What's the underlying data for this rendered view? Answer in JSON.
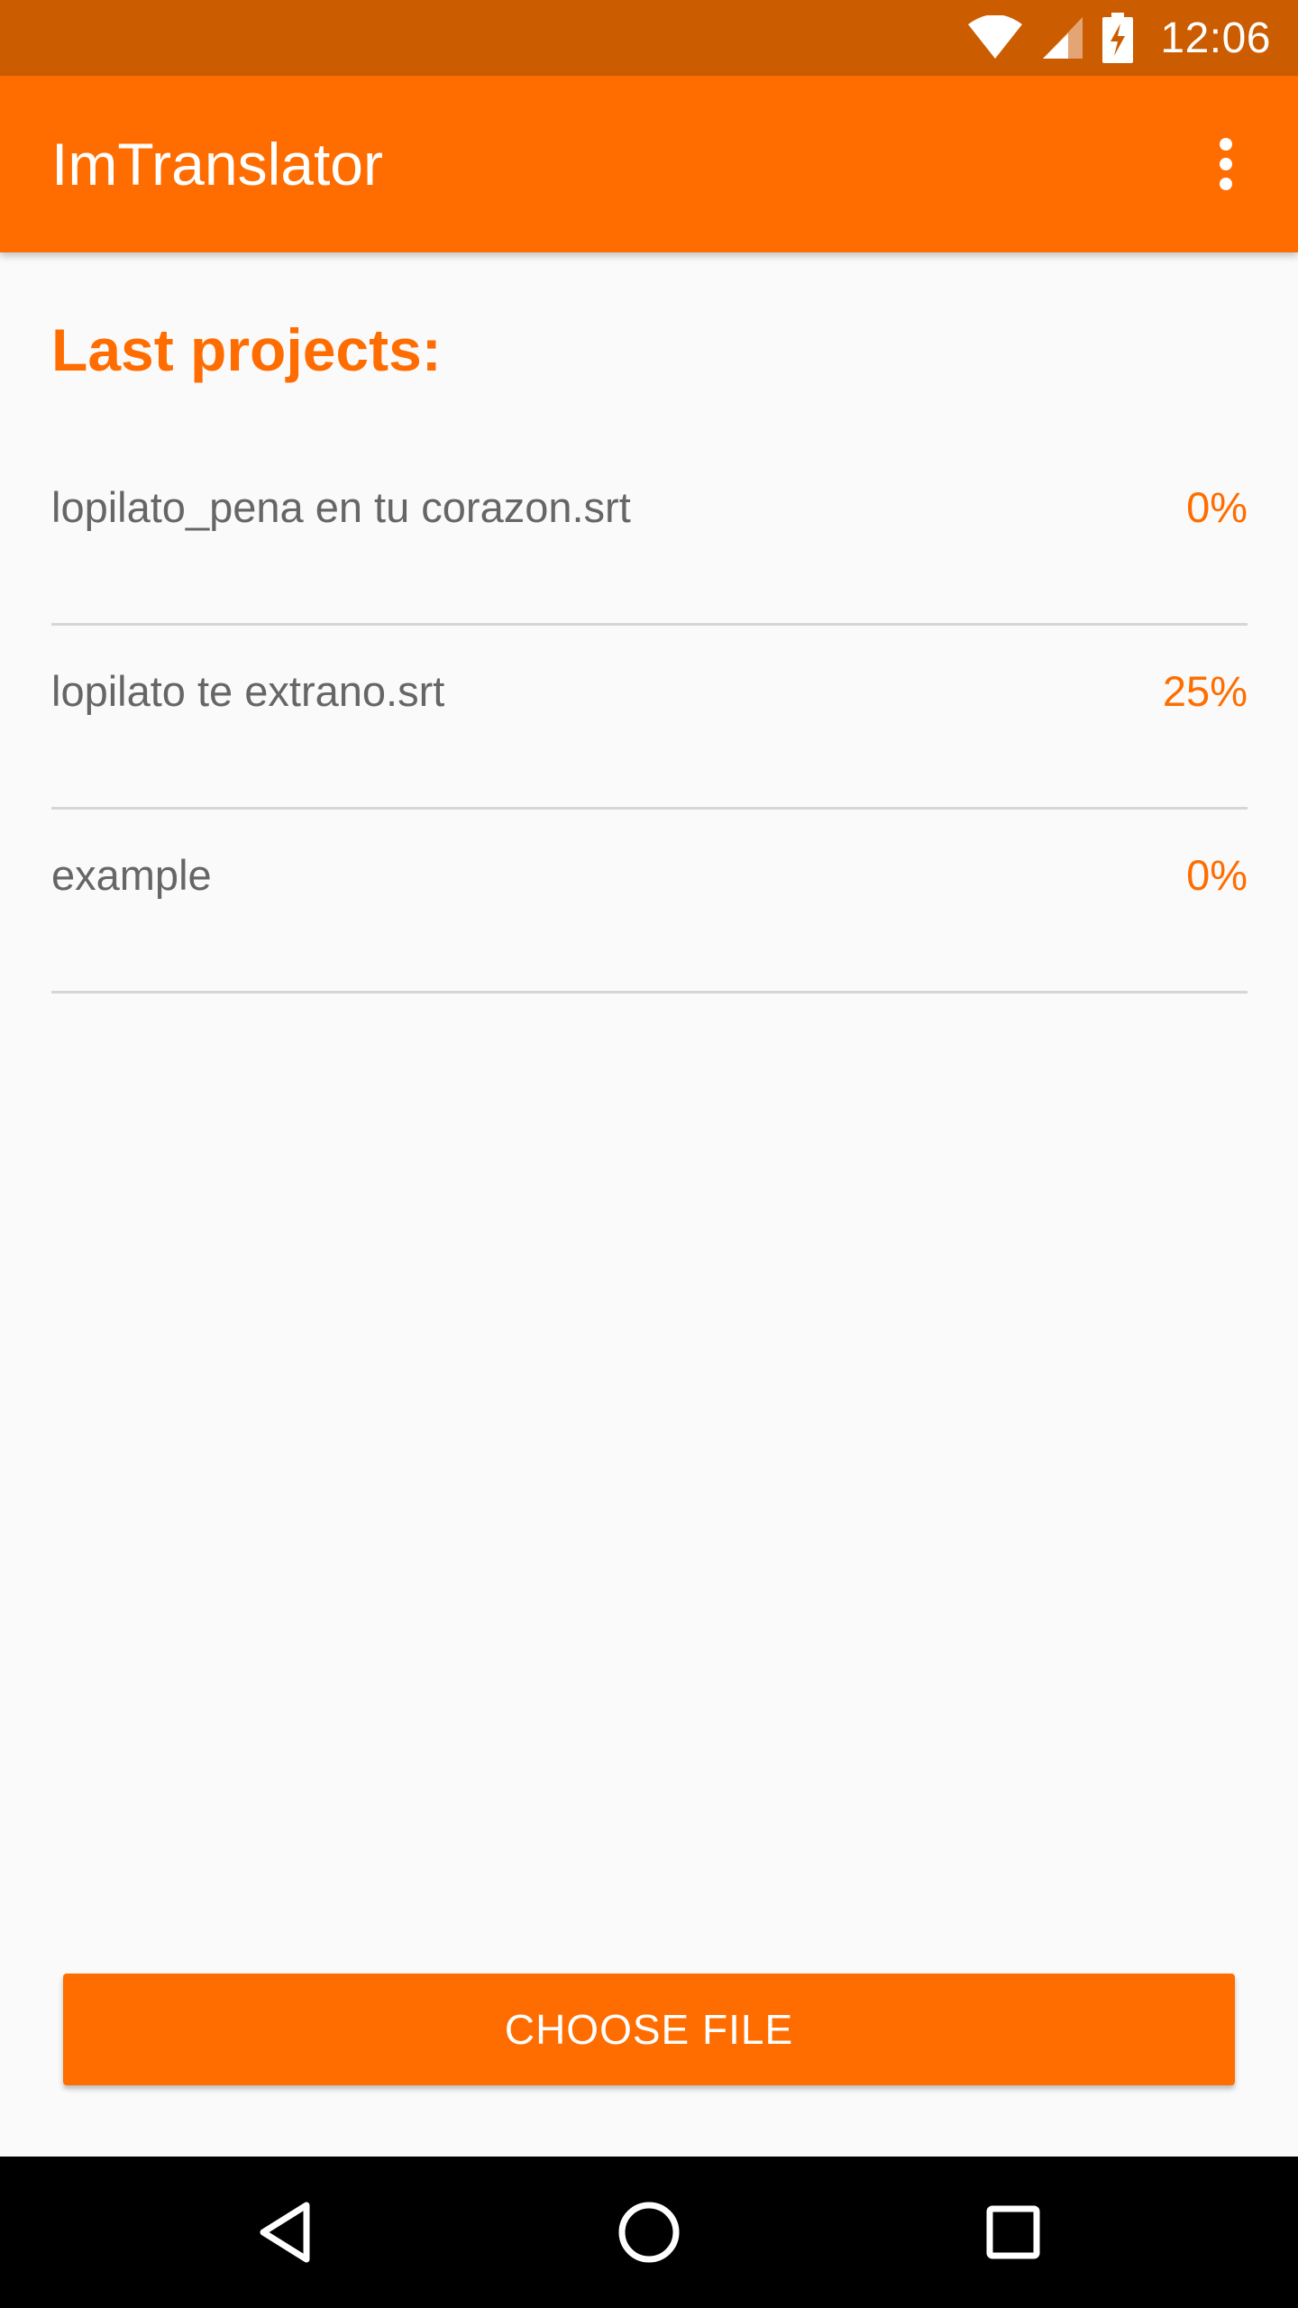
{
  "status_bar": {
    "time": "12:06",
    "icons": [
      "wifi-icon",
      "cell-signal-icon",
      "battery-charging-icon"
    ]
  },
  "app_bar": {
    "title": "ImTranslator",
    "menu_icon": "more-vert-icon"
  },
  "main": {
    "section_title": "Last projects:",
    "projects": [
      {
        "name": "lopilato_pena en tu corazon.srt",
        "progress": "0%"
      },
      {
        "name": "lopilato te extrano.srt",
        "progress": "25%"
      },
      {
        "name": "example",
        "progress": "0%"
      }
    ],
    "choose_file_label": "CHOOSE FILE"
  },
  "nav_bar": {
    "icons": [
      "back-icon",
      "home-icon",
      "recents-icon"
    ]
  },
  "colors": {
    "accent": "#ff6d00",
    "status_bar": "#cc5c00",
    "background": "#fafafa",
    "text_secondary": "#666666",
    "divider": "#d6d6d6"
  }
}
